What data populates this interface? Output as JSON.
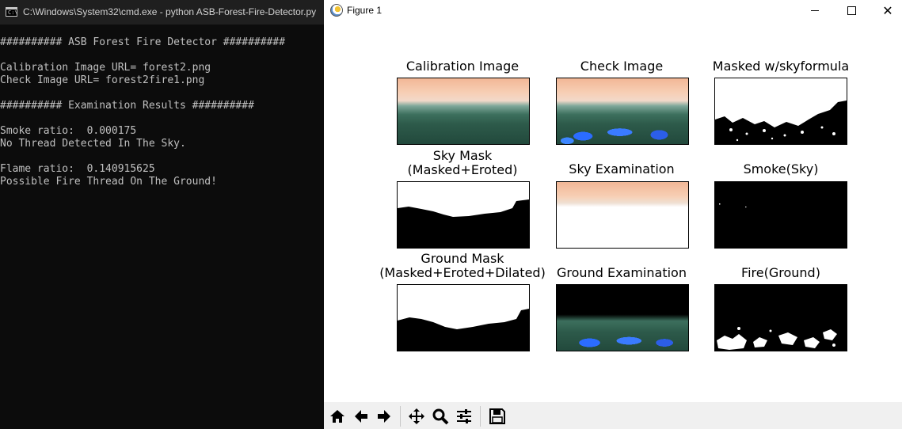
{
  "console": {
    "title": "C:\\Windows\\System32\\cmd.exe - python  ASB-Forest-Fire-Detector.py",
    "lines": [
      "########## ASB Forest Fire Detector ##########",
      "",
      "Calibration Image URL= forest2.png",
      "Check Image URL= forest2fire1.png",
      "",
      "########## Examination Results ##########",
      "",
      "Smoke ratio:  0.000175",
      "No Thread Detected In The Sky.",
      "",
      "Flame ratio:  0.140915625",
      "Possible Fire Thread On The Ground!"
    ]
  },
  "figure": {
    "title": "Figure 1",
    "close_glyph": "✕",
    "subplots": [
      {
        "title": "Calibration Image",
        "image": "forest-photo"
      },
      {
        "title": "Check Image",
        "image": "forest-photo-with-fire"
      },
      {
        "title": "Masked w/skyformula",
        "image": "binary-mask"
      },
      {
        "title": "Sky Mask\n(Masked+Eroted)",
        "image": "binary-mask"
      },
      {
        "title": "Sky Examination",
        "image": "sky-region"
      },
      {
        "title": "Smoke(Sky)",
        "image": "binary-mask"
      },
      {
        "title": "Ground Mask\n(Masked+Eroted+Dilated)",
        "image": "binary-mask"
      },
      {
        "title": "Ground Examination",
        "image": "ground-region"
      },
      {
        "title": "Fire(Ground)",
        "image": "binary-mask"
      }
    ]
  },
  "toolbar": {
    "buttons": [
      "home-icon",
      "back-icon",
      "forward-icon",
      "pan-icon",
      "zoom-icon",
      "configure-subplots-icon",
      "save-icon"
    ]
  }
}
